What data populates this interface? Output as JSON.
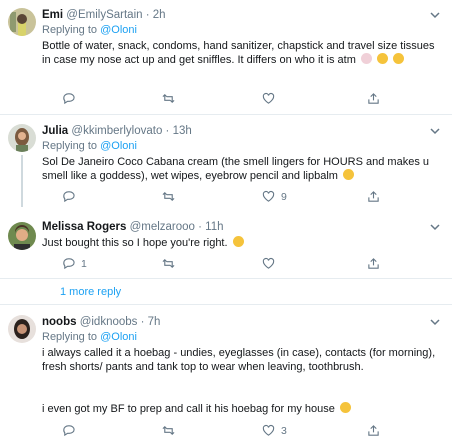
{
  "tweets": [
    {
      "name": "Emi",
      "handle": "@EmilySartain",
      "time": "· 2h",
      "replying_prefix": "Replying to ",
      "replying_to": "@Oloni",
      "text": "Bottle of water, snack, condoms, hand sanitizer, chapstick and travel size tissues in case my nose act up and get sniffles. It differs on who it is atm",
      "emojis": [
        "woman-shrugging-emoji",
        "laughing-emoji",
        "laughing-emoji"
      ],
      "counts": {
        "reply": "",
        "retweet": "",
        "like": ""
      }
    },
    {
      "name": "Julia",
      "handle": "@kkimberlylovato",
      "time": "· 13h",
      "replying_prefix": "Replying to ",
      "replying_to": "@Oloni",
      "text": "Sol De Janeiro Coco Cabana cream (the smell lingers for HOURS and makes u smell like a goddess), wet wipes, eyebrow pencil and lipbalm",
      "emojis": [
        "tongue-wink-emoji"
      ],
      "counts": {
        "reply": "",
        "retweet": "",
        "like": "9"
      }
    },
    {
      "name": "Melissa Rogers",
      "handle": "@melzarooo",
      "time": "· 11h",
      "replying_prefix": "",
      "replying_to": "",
      "text": "Just bought this so I hope you're right.",
      "emojis": [
        "grimace-emoji"
      ],
      "counts": {
        "reply": "1",
        "retweet": "",
        "like": ""
      }
    },
    {
      "name": "noobs",
      "handle": "@idknoobs",
      "time": "· 7h",
      "replying_prefix": "Replying to ",
      "replying_to": "@Oloni",
      "text": "i always called it a hoebag - undies, eyeglasses (in case), contacts (for morning), fresh shorts/ pants and tank top to wear when leaving, toothbrush.",
      "text2": "i even got my BF to prep and call it his hoebag for my house",
      "emojis": [
        "grin-emoji"
      ],
      "counts": {
        "reply": "",
        "retweet": "",
        "like": "3"
      }
    }
  ],
  "more_replies": "1 more reply",
  "colors": {
    "accent": "#1da1f2",
    "muted": "#657786",
    "emoji": "#f5c33b"
  }
}
